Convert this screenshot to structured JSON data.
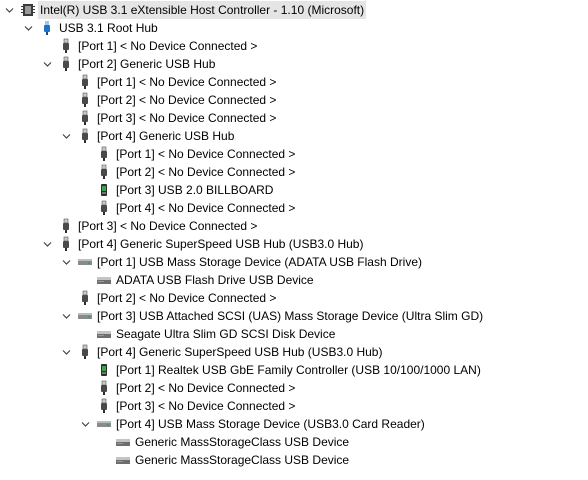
{
  "tree": {
    "nodes": [
      {
        "label": "Intel(R) USB 3.1 eXtensible Host Controller - 1.10 (Microsoft)",
        "icon": "host-controller-icon",
        "depth": 0,
        "expanded": true,
        "selected": true
      },
      {
        "label": "USB 3.1 Root Hub",
        "icon": "usb-root-hub-icon",
        "depth": 1,
        "expanded": true
      },
      {
        "label": "[Port 1] < No Device Connected >",
        "icon": "usb-port-icon",
        "depth": 2
      },
      {
        "label": "[Port 2] Generic USB Hub",
        "icon": "usb-port-icon",
        "depth": 2,
        "expanded": true
      },
      {
        "label": "[Port 1] < No Device Connected >",
        "icon": "usb-port-icon",
        "depth": 3
      },
      {
        "label": "[Port 2] < No Device Connected >",
        "icon": "usb-port-icon",
        "depth": 3
      },
      {
        "label": "[Port 3] < No Device Connected >",
        "icon": "usb-port-icon",
        "depth": 3
      },
      {
        "label": "[Port 4] Generic USB Hub",
        "icon": "usb-port-icon",
        "depth": 3,
        "expanded": true
      },
      {
        "label": "[Port 1] < No Device Connected >",
        "icon": "usb-port-icon",
        "depth": 4
      },
      {
        "label": "[Port 2] < No Device Connected >",
        "icon": "usb-port-icon",
        "depth": 4
      },
      {
        "label": "[Port 3] USB 2.0 BILLBOARD",
        "icon": "usb-device-icon",
        "depth": 4
      },
      {
        "label": "[Port 4] < No Device Connected >",
        "icon": "usb-port-icon",
        "depth": 4
      },
      {
        "label": "[Port 3] < No Device Connected >",
        "icon": "usb-port-icon",
        "depth": 2
      },
      {
        "label": "[Port 4] Generic SuperSpeed USB Hub (USB3.0 Hub)",
        "icon": "usb-port-icon",
        "depth": 2,
        "expanded": true
      },
      {
        "label": "[Port 1] USB Mass Storage Device (ADATA USB Flash Drive)",
        "icon": "drive-icon",
        "depth": 3,
        "expanded": true
      },
      {
        "label": "ADATA USB Flash Drive USB Device",
        "icon": "disk-drive-icon",
        "depth": 4
      },
      {
        "label": "[Port 2] < No Device Connected >",
        "icon": "usb-port-icon",
        "depth": 3
      },
      {
        "label": "[Port 3] USB Attached SCSI (UAS) Mass Storage Device (Ultra Slim GD)",
        "icon": "drive-icon",
        "depth": 3,
        "expanded": true
      },
      {
        "label": "Seagate Ultra Slim GD SCSI Disk Device",
        "icon": "disk-drive-icon",
        "depth": 4
      },
      {
        "label": "[Port 4] Generic SuperSpeed USB Hub (USB3.0 Hub)",
        "icon": "usb-port-icon",
        "depth": 3,
        "expanded": true
      },
      {
        "label": "[Port 1] Realtek USB GbE Family Controller (USB 10/100/1000 LAN)",
        "icon": "usb-device-icon",
        "depth": 4
      },
      {
        "label": "[Port 2] < No Device Connected >",
        "icon": "usb-port-icon",
        "depth": 4
      },
      {
        "label": "[Port 3] < No Device Connected >",
        "icon": "usb-port-icon",
        "depth": 4
      },
      {
        "label": "[Port 4] USB Mass Storage Device (USB3.0 Card Reader)",
        "icon": "drive-icon",
        "depth": 4,
        "expanded": true
      },
      {
        "label": "Generic MassStorageClass USB Device",
        "icon": "disk-drive-icon",
        "depth": 5
      },
      {
        "label": "Generic MassStorageClass USB Device",
        "icon": "disk-drive-icon",
        "depth": 5
      }
    ]
  },
  "colors": {
    "selection": "#e5e5e5",
    "usb_blue": "#1e73c8"
  }
}
